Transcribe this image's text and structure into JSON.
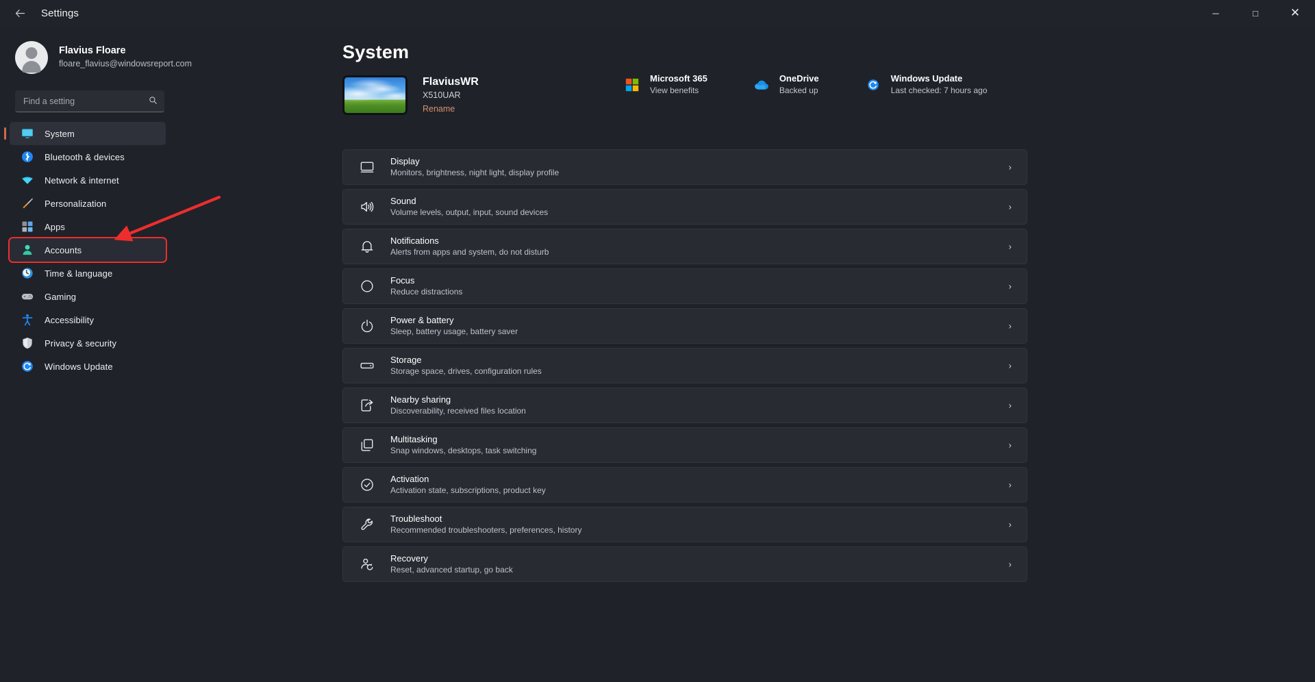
{
  "titlebar": {
    "back_icon": "back-arrow-icon",
    "title": "Settings",
    "minimize": "─",
    "maximize": "□",
    "close": "✕"
  },
  "sidebar": {
    "profile": {
      "name": "Flavius Floare",
      "email": "floare_flavius@windowsreport.com"
    },
    "search": {
      "placeholder": "Find a setting",
      "value": "",
      "icon": "search-icon"
    },
    "items": [
      {
        "label": "System",
        "icon": "display-monitor-icon",
        "state": "active"
      },
      {
        "label": "Bluetooth & devices",
        "icon": "bluetooth-icon",
        "state": "normal"
      },
      {
        "label": "Network & internet",
        "icon": "wifi-icon",
        "state": "normal"
      },
      {
        "label": "Personalization",
        "icon": "paintbrush-icon",
        "state": "normal"
      },
      {
        "label": "Apps",
        "icon": "apps-grid-icon",
        "state": "normal"
      },
      {
        "label": "Accounts",
        "icon": "person-account-icon",
        "state": "highlighted"
      },
      {
        "label": "Time & language",
        "icon": "clock-globe-icon",
        "state": "normal"
      },
      {
        "label": "Gaming",
        "icon": "gamepad-icon",
        "state": "normal"
      },
      {
        "label": "Accessibility",
        "icon": "accessibility-person-icon",
        "state": "normal"
      },
      {
        "label": "Privacy & security",
        "icon": "shield-icon",
        "state": "normal"
      },
      {
        "label": "Windows Update",
        "icon": "update-refresh-icon",
        "state": "normal"
      }
    ]
  },
  "annotation": {
    "type": "red-arrow-pointing-to-accounts",
    "color": "#ee2d2d"
  },
  "main": {
    "page_title": "System",
    "device": {
      "name": "FlaviusWR",
      "model": "X510UAR",
      "rename_label": "Rename",
      "rename_color": "#d79070",
      "thumbnail": "bliss-wallpaper-device-thumbnail"
    },
    "status": [
      {
        "title": "Microsoft 365",
        "sub": "View benefits",
        "icon": "microsoft-logo-icon"
      },
      {
        "title": "OneDrive",
        "sub": "Backed up",
        "icon": "onedrive-cloud-icon"
      },
      {
        "title": "Windows Update",
        "sub": "Last checked: 7 hours ago",
        "icon": "update-refresh-icon"
      }
    ],
    "rows": [
      {
        "title": "Display",
        "sub": "Monitors, brightness, night light, display profile",
        "icon": "monitor-icon"
      },
      {
        "title": "Sound",
        "sub": "Volume levels, output, input, sound devices",
        "icon": "speaker-icon"
      },
      {
        "title": "Notifications",
        "sub": "Alerts from apps and system, do not disturb",
        "icon": "bell-icon"
      },
      {
        "title": "Focus",
        "sub": "Reduce distractions",
        "icon": "focus-moon-icon"
      },
      {
        "title": "Power & battery",
        "sub": "Sleep, battery usage, battery saver",
        "icon": "power-icon"
      },
      {
        "title": "Storage",
        "sub": "Storage space, drives, configuration rules",
        "icon": "drive-icon"
      },
      {
        "title": "Nearby sharing",
        "sub": "Discoverability, received files location",
        "icon": "share-icon"
      },
      {
        "title": "Multitasking",
        "sub": "Snap windows, desktops, task switching",
        "icon": "windows-stack-icon"
      },
      {
        "title": "Activation",
        "sub": "Activation state, subscriptions, product key",
        "icon": "check-circle-icon"
      },
      {
        "title": "Troubleshoot",
        "sub": "Recommended troubleshooters, preferences, history",
        "icon": "wrench-icon"
      },
      {
        "title": "Recovery",
        "sub": "Reset, advanced startup, go back",
        "icon": "recovery-icon"
      }
    ],
    "chevron": "›"
  }
}
